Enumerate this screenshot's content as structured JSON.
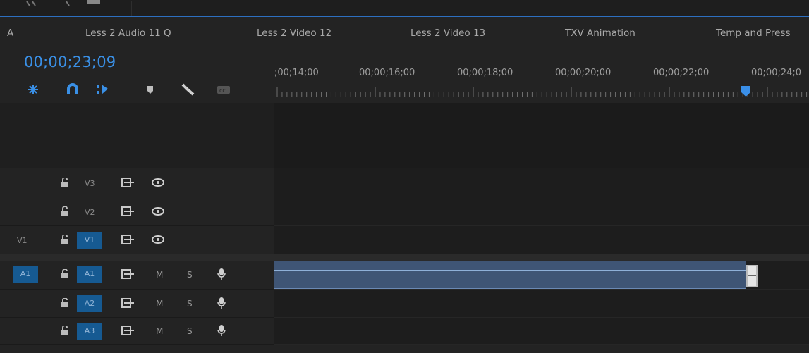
{
  "tabs": [
    {
      "label": "A"
    },
    {
      "label": "Less 2 Audio 11 Q"
    },
    {
      "label": "Less 2 Video 12"
    },
    {
      "label": "Less 2 Video 13"
    },
    {
      "label": "TXV Animation"
    },
    {
      "label": "Temp and Press"
    }
  ],
  "timecode": "00;00;23;09",
  "header_tools": [
    "snap-icon",
    "magnet-icon",
    "linked-selection-icon",
    "marker-icon",
    "wrench-icon",
    "captions-icon"
  ],
  "ruler": {
    "labels": [
      ";00;14;00",
      "00;00;16;00",
      "00;00;18;00",
      "00;00;20;00",
      "00;00;22;00",
      "00;00;24;0"
    ]
  },
  "video_tracks": [
    {
      "source": "",
      "name": "V3"
    },
    {
      "source": "",
      "name": "V2"
    },
    {
      "source": "V1",
      "name": "V1"
    }
  ],
  "audio_tracks": [
    {
      "source": "A1",
      "name": "A1",
      "mute": "M",
      "solo": "S"
    },
    {
      "source": "",
      "name": "A2",
      "mute": "M",
      "solo": "S"
    },
    {
      "source": "",
      "name": "A3",
      "mute": "M",
      "solo": "S"
    }
  ],
  "colors": {
    "accent": "#3a90e6",
    "patch": "#165a92",
    "clip": "#3f5575"
  }
}
